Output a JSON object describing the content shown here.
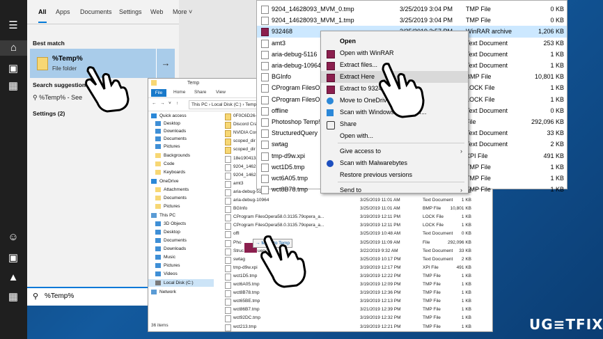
{
  "start_menu": {
    "tabs": [
      "All",
      "Apps",
      "Documents",
      "Settings",
      "Web",
      "More"
    ],
    "best_match_title": "Best match",
    "best_match_name": "%Temp%",
    "best_match_type": "File folder",
    "search_suggestions_title": "Search suggestions",
    "suggestion_text": "%Temp% - See",
    "settings_title": "Settings (2)",
    "search_query": "%Temp%"
  },
  "explorer": {
    "title": "Temp",
    "ribbon": [
      "File",
      "Home",
      "Share",
      "View"
    ],
    "address": [
      "This PC",
      "Local Disk (C:)",
      "Temp"
    ],
    "nav": [
      {
        "label": "Quick access",
        "type": "star"
      },
      {
        "label": "Desktop",
        "type": "blue"
      },
      {
        "label": "Downloads",
        "type": "blue"
      },
      {
        "label": "Documents",
        "type": "blue"
      },
      {
        "label": "Pictures",
        "type": "blue"
      },
      {
        "label": "Backgrounds",
        "type": "folder"
      },
      {
        "label": "Code",
        "type": "folder"
      },
      {
        "label": "Keyboards",
        "type": "folder"
      },
      {
        "label": "OneDrive",
        "type": "cloud"
      },
      {
        "label": "Attachments",
        "type": "folder"
      },
      {
        "label": "Documents",
        "type": "folder"
      },
      {
        "label": "Pictures",
        "type": "folder"
      },
      {
        "label": "This PC",
        "type": "pc"
      },
      {
        "label": "3D Objects",
        "type": "blue"
      },
      {
        "label": "Desktop",
        "type": "blue"
      },
      {
        "label": "Documents",
        "type": "blue"
      },
      {
        "label": "Downloads",
        "type": "blue"
      },
      {
        "label": "Music",
        "type": "blue"
      },
      {
        "label": "Pictures",
        "type": "blue"
      },
      {
        "label": "Videos",
        "type": "blue"
      },
      {
        "label": "Local Disk (C:)",
        "type": "drive"
      },
      {
        "label": "Network",
        "type": "net"
      }
    ],
    "files": [
      {
        "name": "0F0C6D26-",
        "date": "",
        "type": "",
        "size": "",
        "folder": true
      },
      {
        "name": "Discord Cra",
        "date": "",
        "type": "",
        "size": "",
        "folder": true
      },
      {
        "name": "NVIDIA Corp",
        "date": "",
        "type": "",
        "size": "",
        "folder": true
      },
      {
        "name": "scoped_dir",
        "date": "",
        "type": "",
        "size": "",
        "folder": true
      },
      {
        "name": "scoped_dir",
        "date": "",
        "type": "",
        "size": "",
        "folder": true
      },
      {
        "name": "18e190413a",
        "date": "",
        "type": "",
        "size": "",
        "folder": false
      },
      {
        "name": "9204_14628",
        "date": "",
        "type": "",
        "size": "",
        "folder": false
      },
      {
        "name": "9204_14628",
        "date": "",
        "type": "",
        "size": "",
        "folder": false
      },
      {
        "name": "amt3",
        "date": "",
        "type": "",
        "size": "",
        "folder": false
      },
      {
        "name": "aria-debug-5116",
        "date": "3/25/2019 11:01 AM",
        "type": "Text Document",
        "size": "1 KB",
        "folder": false
      },
      {
        "name": "aria-debug-10964",
        "date": "3/25/2019 11:01 AM",
        "type": "Text Document",
        "size": "1 KB",
        "folder": false
      },
      {
        "name": "BGInfo",
        "date": "3/25/2019 11:01 AM",
        "type": "BMP File",
        "size": "10,801 KB",
        "folder": false
      },
      {
        "name": "CProgram FilesOpera58.0.3135.79opera_a...",
        "date": "3/19/2019 12:11 PM",
        "type": "LOCK File",
        "size": "1 KB",
        "folder": false
      },
      {
        "name": "CProgram FilesOpera58.0.3135.79opera_a...",
        "date": "3/19/2019 12:11 PM",
        "type": "LOCK File",
        "size": "1 KB",
        "folder": false
      },
      {
        "name": "offl",
        "date": "3/25/2019 10:48 AM",
        "type": "Text Document",
        "size": "0 KB",
        "folder": false
      },
      {
        "name": "Pho",
        "date": "3/25/2019 11:09 AM",
        "type": "File",
        "size": "292,096 KB",
        "folder": false
      },
      {
        "name": "StructuredQuery",
        "date": "3/22/2019 9:32 AM",
        "type": "Text Document",
        "size": "33 KB",
        "folder": false
      },
      {
        "name": "swtag",
        "date": "3/25/2019 10:17 PM",
        "type": "Text Document",
        "size": "2 KB",
        "folder": false
      },
      {
        "name": "tmp-d9w.xpi",
        "date": "3/19/2019 12:17 PM",
        "type": "XPI File",
        "size": "491 KB",
        "folder": false
      },
      {
        "name": "wct1D5.tmp",
        "date": "3/19/2019 12:22 PM",
        "type": "TMP File",
        "size": "1 KB",
        "folder": false
      },
      {
        "name": "wct6A05.tmp",
        "date": "3/19/2019 12:09 PM",
        "type": "TMP File",
        "size": "1 KB",
        "folder": false
      },
      {
        "name": "wct8B78.tmp",
        "date": "3/19/2019 12:36 PM",
        "type": "TMP File",
        "size": "1 KB",
        "folder": false
      },
      {
        "name": "wct65BE.tmp",
        "date": "3/19/2019 12:13 PM",
        "type": "TMP File",
        "size": "1 KB",
        "folder": false
      },
      {
        "name": "wct86B7.tmp",
        "date": "3/21/2019 12:39 PM",
        "type": "TMP File",
        "size": "1 KB",
        "folder": false
      },
      {
        "name": "wct92DC.tmp",
        "date": "3/19/2019 12:32 PM",
        "type": "TMP File",
        "size": "1 KB",
        "folder": false
      },
      {
        "name": "wct213.tmp",
        "date": "3/19/2019 12:21 PM",
        "type": "TMP File",
        "size": "1 KB",
        "folder": false
      }
    ],
    "drag_tooltip": "Move to Temp",
    "status": "36 items"
  },
  "top_list": [
    {
      "name": "9204_14628093_MVM_0.tmp",
      "date": "3/25/2019 3:04 PM",
      "type": "TMP File",
      "size": "0 KB",
      "icon": "file"
    },
    {
      "name": "9204_14628093_MVM_1.tmp",
      "date": "3/25/2019 3:04 PM",
      "type": "TMP File",
      "size": "0 KB",
      "icon": "file"
    },
    {
      "name": "932468",
      "date": "3/25/2019 3:57 PM",
      "type": "WinRAR archive",
      "size": "1,206 KB",
      "icon": "rar"
    },
    {
      "name": "amt3",
      "date": "",
      "type": "Text Document",
      "size": "253 KB",
      "icon": "file"
    },
    {
      "name": "aria-debug-5116",
      "date": "",
      "type": "Text Document",
      "size": "1 KB",
      "icon": "file"
    },
    {
      "name": "aria-debug-10964",
      "date": "",
      "type": "Text Document",
      "size": "1 KB",
      "icon": "file"
    },
    {
      "name": "BGInfo",
      "date": "",
      "type": "BMP File",
      "size": "10,801 KB",
      "icon": "file"
    },
    {
      "name": "CProgram FilesOp",
      "date": "",
      "type": "LOCK File",
      "size": "1 KB",
      "icon": "file"
    },
    {
      "name": "CProgram FilesOp",
      "date": "",
      "type": "LOCK File",
      "size": "1 KB",
      "icon": "file"
    },
    {
      "name": "offline",
      "date": "",
      "type": "Text Document",
      "size": "0 KB",
      "icon": "file"
    },
    {
      "name": "Photoshop Temp!",
      "date": "",
      "type": "File",
      "size": "292,096 KB",
      "icon": "file"
    },
    {
      "name": "StructuredQuery",
      "date": "",
      "type": "Text Document",
      "size": "33 KB",
      "icon": "file"
    },
    {
      "name": "swtag",
      "date": "",
      "type": "Text Document",
      "size": "2 KB",
      "icon": "file"
    },
    {
      "name": "tmp-d9w.xpi",
      "date": "",
      "type": "XPI File",
      "size": "491 KB",
      "icon": "file"
    },
    {
      "name": "wct1D5.tmp",
      "date": "",
      "type": "TMP File",
      "size": "1 KB",
      "icon": "file"
    },
    {
      "name": "wct6A05.tmp",
      "date": "",
      "type": "TMP File",
      "size": "1 KB",
      "icon": "file"
    },
    {
      "name": "wct8B78.tmp",
      "date": "",
      "type": "TMP File",
      "size": "1 KB",
      "icon": "file"
    }
  ],
  "context_menu": [
    {
      "label": "Open",
      "bold": true,
      "icon": "",
      "sub": false
    },
    {
      "label": "Open with WinRAR",
      "icon": "rar",
      "sub": false
    },
    {
      "label": "Extract files...",
      "icon": "rar",
      "sub": false
    },
    {
      "label": "Extract Here",
      "icon": "rar",
      "sub": false,
      "highlight": true
    },
    {
      "label": "Extract to 932468\\",
      "icon": "rar",
      "sub": false
    },
    {
      "label": "Move to OneDrive",
      "icon": "cloud",
      "sub": false
    },
    {
      "label": "Scan with Windows Defender...",
      "icon": "shield",
      "sub": false
    },
    {
      "label": "Share",
      "icon": "share",
      "sub": false
    },
    {
      "label": "Open with...",
      "icon": "",
      "sub": false
    },
    {
      "label": "Give access to",
      "icon": "",
      "sub": true
    },
    {
      "label": "Scan with Malwarebytes",
      "icon": "mb",
      "sub": false
    },
    {
      "label": "Restore previous versions",
      "icon": "",
      "sub": false
    },
    {
      "label": "Send to",
      "icon": "",
      "sub": true
    }
  ],
  "logo": "UG≡TFIX",
  "colors": {
    "accent": "#0078d7",
    "selection": "#a9ccea",
    "winrar": "#8b1f4e"
  }
}
